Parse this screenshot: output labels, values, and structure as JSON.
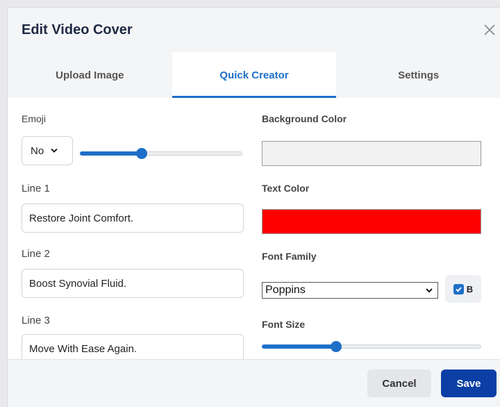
{
  "dialog": {
    "title": "Edit Video Cover"
  },
  "tabs": [
    {
      "label": "Upload Image",
      "active": false
    },
    {
      "label": "Quick Creator",
      "active": true
    },
    {
      "label": "Settings",
      "active": false
    }
  ],
  "left": {
    "emoji_label": "Emoji",
    "emoji_value": "No",
    "emoji_slider_fraction": 0.38,
    "line1_label": "Line 1",
    "line1_value": "Restore Joint Comfort.",
    "line2_label": "Line 2",
    "line2_value": "Boost Synovial Fluid.",
    "line3_label": "Line 3",
    "line3_value": "Move With Ease Again."
  },
  "right": {
    "bg_color_label": "Background Color",
    "bg_color_value": "#f2f2f2",
    "text_color_label": "Text Color",
    "text_color_value": "#ff0000",
    "font_family_label": "Font Family",
    "font_family_value": "Poppins",
    "bold_checked": true,
    "bold_label": "B",
    "font_size_label": "Font Size",
    "font_size_slider_fraction": 0.34
  },
  "footer": {
    "cancel_label": "Cancel",
    "save_label": "Save"
  },
  "colors": {
    "accent": "#1e6fc7",
    "save_button": "#0b3fa6"
  }
}
